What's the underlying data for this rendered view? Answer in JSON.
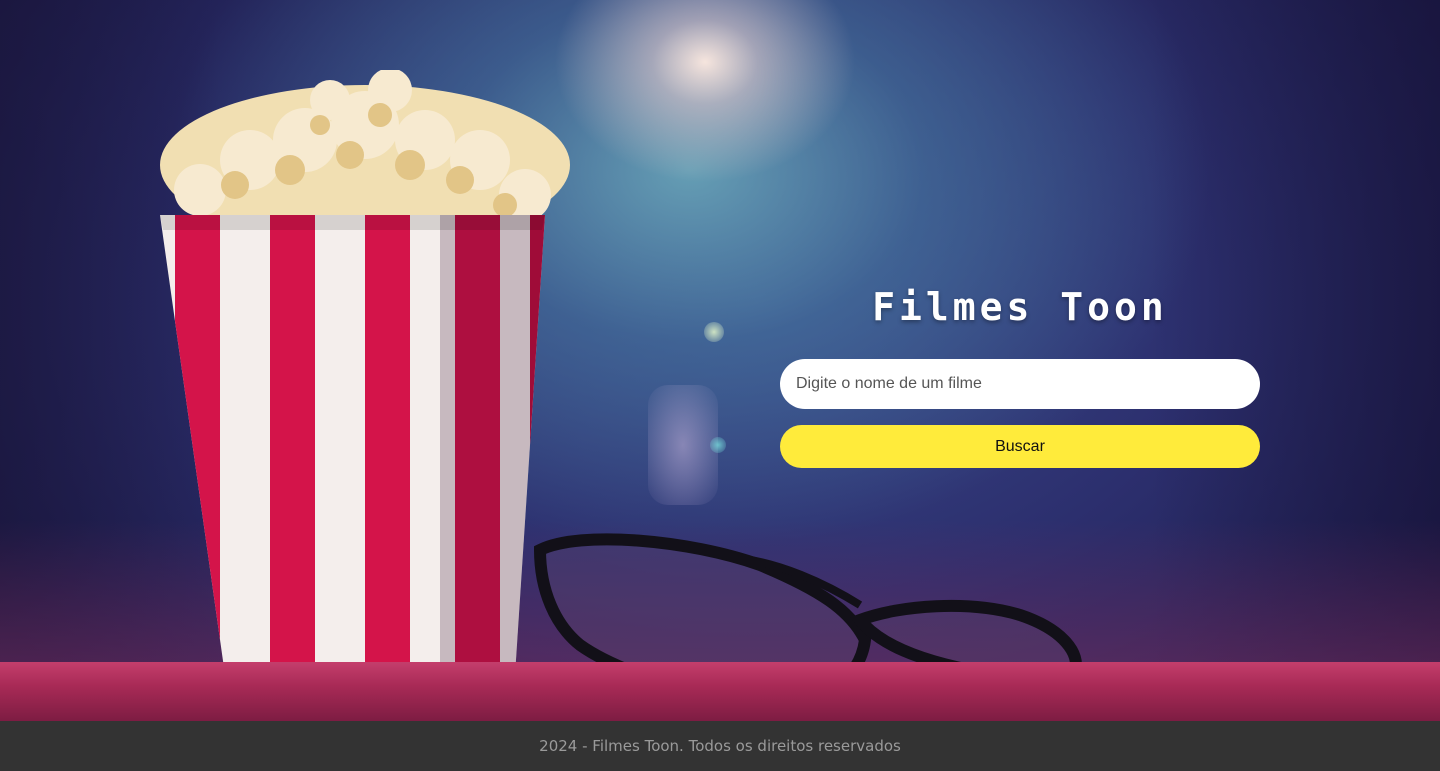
{
  "app": {
    "title": "Filmes Toon"
  },
  "search": {
    "placeholder": "Digite o nome de um filme",
    "value": "",
    "button_label": "Buscar"
  },
  "footer": {
    "copyright": "2024 - Filmes Toon. Todos os direitos reservados"
  },
  "colors": {
    "button_accent": "#ffeb3b",
    "footer_background": "#333333",
    "footer_text": "#9a9a9a"
  },
  "background": {
    "image_subject": [
      "popcorn-box-illustration",
      "3d-glasses-illustration",
      "cinema-projector-light"
    ]
  }
}
